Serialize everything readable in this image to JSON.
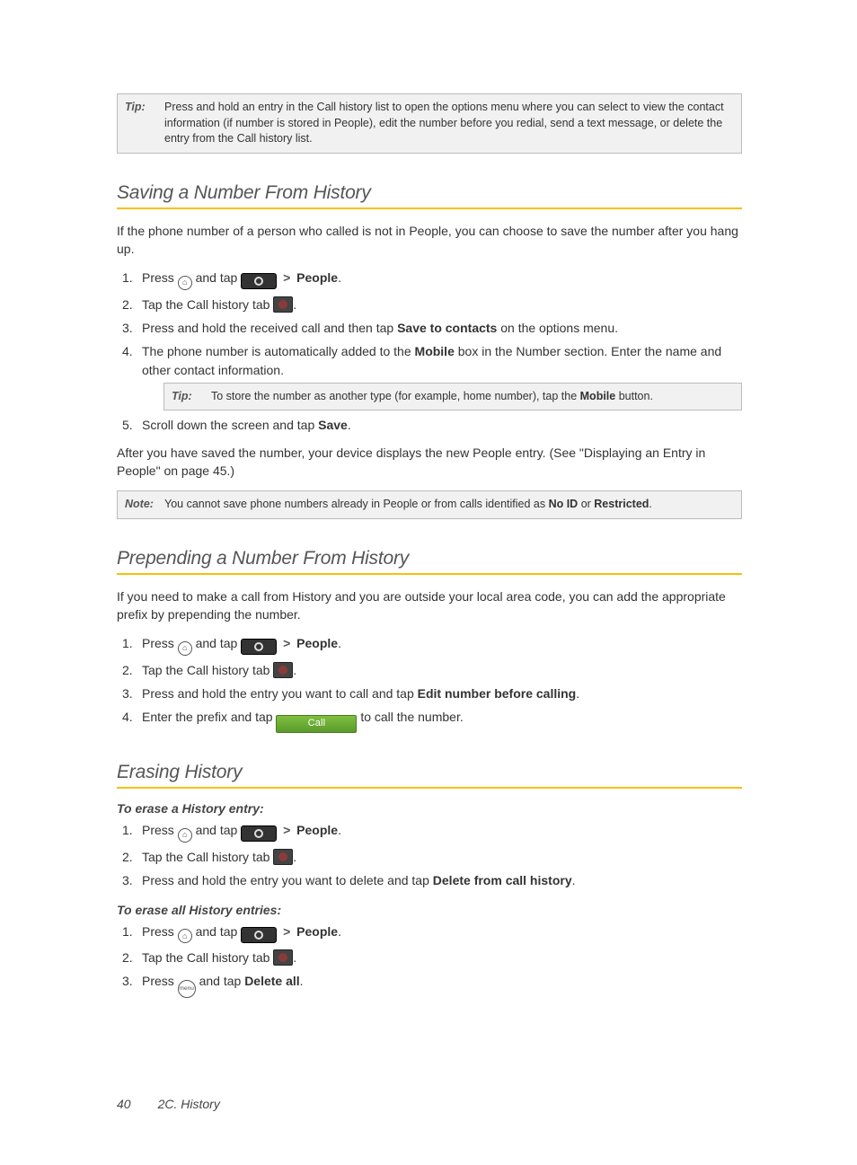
{
  "tip_top": {
    "label": "Tip:",
    "text": "Press and hold an entry in the Call history list to open the options menu where you can select to view the contact information (if number is stored in People), edit the number before you redial, send a text message, or delete the entry from the Call history list."
  },
  "section1": {
    "title": "Saving a Number From History",
    "intro": "If the phone number of a person who called is not in People, you can choose to save the number after you hang up.",
    "steps": {
      "s1": {
        "a": "Press ",
        "b": " and tap ",
        "c": "People",
        "d": "."
      },
      "s2": {
        "a": "Tap the Call history tab ",
        "b": "."
      },
      "s3": {
        "a": "Press and hold the received call and then tap ",
        "b": "Save to contacts",
        "c": " on the options menu."
      },
      "s4": {
        "a": "The phone number is automatically added to the ",
        "b": "Mobile",
        "c": " box in the Number section. Enter the name and other contact information."
      },
      "tip": {
        "label": "Tip:",
        "a": "To store the number as another type (for example, home number), tap the ",
        "b": "Mobile",
        "c": " button."
      },
      "s5": {
        "a": "Scroll down the screen and tap ",
        "b": "Save",
        "c": "."
      }
    },
    "outro": "After you have saved the number, your device displays the new People entry. (See \"Displaying an Entry in People\" on page 45.)",
    "note": {
      "label": "Note:",
      "a": "You cannot save phone numbers already in People or from calls identified as ",
      "b": "No ID",
      "c": " or ",
      "d": "Restricted",
      "e": "."
    }
  },
  "section2": {
    "title": "Prepending a Number From History",
    "intro": "If you need to make a call from History and you are outside your local area code, you can add the appropriate prefix by prepending the number.",
    "steps": {
      "s1": {
        "a": "Press ",
        "b": " and tap ",
        "c": "People",
        "d": "."
      },
      "s2": {
        "a": "Tap the Call history tab ",
        "b": "."
      },
      "s3": {
        "a": "Press and hold the entry you want to call and tap ",
        "b": "Edit number before calling",
        "c": "."
      },
      "s4": {
        "a": "Enter the prefix and tap ",
        "call": "Call",
        "c": " to call the number."
      }
    }
  },
  "section3": {
    "title": "Erasing History",
    "sub1": "To erase a History entry:",
    "steps1": {
      "s1": {
        "a": "Press ",
        "b": " and tap ",
        "c": "People",
        "d": "."
      },
      "s2": {
        "a": "Tap the Call history tab ",
        "b": "."
      },
      "s3": {
        "a": "Press and hold the entry you want to delete and tap ",
        "b": "Delete from call history",
        "c": "."
      }
    },
    "sub2": "To erase all History entries:",
    "steps2": {
      "s1": {
        "a": "Press ",
        "b": " and tap ",
        "c": "People",
        "d": "."
      },
      "s2": {
        "a": "Tap the Call history tab ",
        "b": "."
      },
      "s3": {
        "a": "Press ",
        "menu": "menu",
        "b": " and tap ",
        "c": "Delete all",
        "d": "."
      }
    }
  },
  "footer": {
    "page": "40",
    "breadcrumb": "2C. History"
  }
}
